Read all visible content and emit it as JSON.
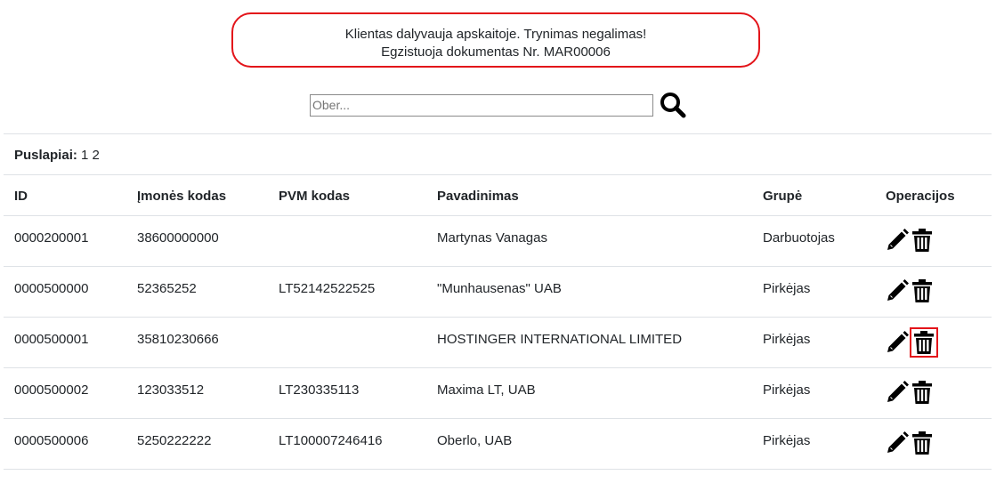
{
  "alert": {
    "line1": "Klientas dalyvauja apskaitoje. Trynimas negalimas!",
    "line2": "Egzistuoja dokumentas Nr. MAR00006"
  },
  "search": {
    "placeholder": "Ober...",
    "value": "",
    "button_icon": "search-icon"
  },
  "pagination": {
    "label": "Puslapiai:",
    "pages": [
      "1",
      "2"
    ]
  },
  "table": {
    "columns": [
      "ID",
      "Įmonės kodas",
      "PVM kodas",
      "Pavadinimas",
      "Grupė",
      "Operacijos"
    ],
    "rows": [
      {
        "id": "0000200001",
        "company_code": "38600000000",
        "vat_code": "",
        "name": "Martynas Vanagas",
        "group": "Darbuotojas"
      },
      {
        "id": "0000500000",
        "company_code": "52365252",
        "vat_code": "LT52142522525",
        "name": "\"Munhausenas\" UAB",
        "group": "Pirkėjas"
      },
      {
        "id": "0000500001",
        "company_code": "35810230666",
        "vat_code": "",
        "name": "HOSTINGER INTERNATIONAL LIMITED",
        "group": "Pirkėjas"
      },
      {
        "id": "0000500002",
        "company_code": "123033512",
        "vat_code": "LT230335113",
        "name": "Maxima LT, UAB",
        "group": "Pirkėjas"
      },
      {
        "id": "0000500006",
        "company_code": "5250222222",
        "vat_code": "LT100007246416",
        "name": "Oberlo, UAB",
        "group": "Pirkėjas"
      }
    ],
    "operation_icons": [
      "pencil-icon",
      "trash-icon"
    ],
    "highlight_color": "#e3141a"
  }
}
